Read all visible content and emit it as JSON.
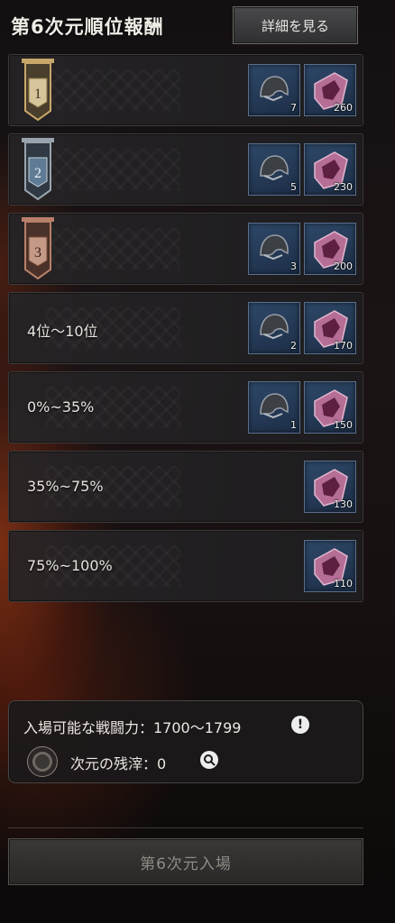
{
  "header": {
    "title": "第6次元順位報酬",
    "details_button": "詳細を見る"
  },
  "rewards": [
    {
      "rank_label": "1",
      "rank_type": "gold-banner",
      "items": [
        {
          "icon": "helmet-icon",
          "count": "7"
        },
        {
          "icon": "crystal-icon",
          "count": "260"
        }
      ]
    },
    {
      "rank_label": "2",
      "rank_type": "silver-banner",
      "items": [
        {
          "icon": "helmet-icon",
          "count": "5"
        },
        {
          "icon": "crystal-icon",
          "count": "230"
        }
      ]
    },
    {
      "rank_label": "3",
      "rank_type": "bronze-banner",
      "items": [
        {
          "icon": "helmet-icon",
          "count": "3"
        },
        {
          "icon": "crystal-icon",
          "count": "200"
        }
      ]
    },
    {
      "rank_label": "4位～10位",
      "rank_type": "text",
      "items": [
        {
          "icon": "helmet-icon",
          "count": "2"
        },
        {
          "icon": "crystal-icon",
          "count": "170"
        }
      ]
    },
    {
      "rank_label": "0%~35%",
      "rank_type": "text",
      "items": [
        {
          "icon": "helmet-icon",
          "count": "1"
        },
        {
          "icon": "crystal-icon",
          "count": "150"
        }
      ]
    },
    {
      "rank_label": "35%~75%",
      "rank_type": "text",
      "items": [
        {
          "icon": "crystal-icon",
          "count": "130"
        }
      ]
    },
    {
      "rank_label": "75%~100%",
      "rank_type": "text",
      "items": [
        {
          "icon": "crystal-icon",
          "count": "110"
        }
      ]
    }
  ],
  "info": {
    "power_label": "入場可能な戦闘力：1700～1799",
    "residue_label": "次元の残滓：0"
  },
  "footer": {
    "enter_button": "第6次元入場"
  },
  "colors": {
    "gold": "#c9a76a",
    "silver": "#9aa4ad",
    "bronze": "#b8806a",
    "item_slot": "#2e4868"
  }
}
